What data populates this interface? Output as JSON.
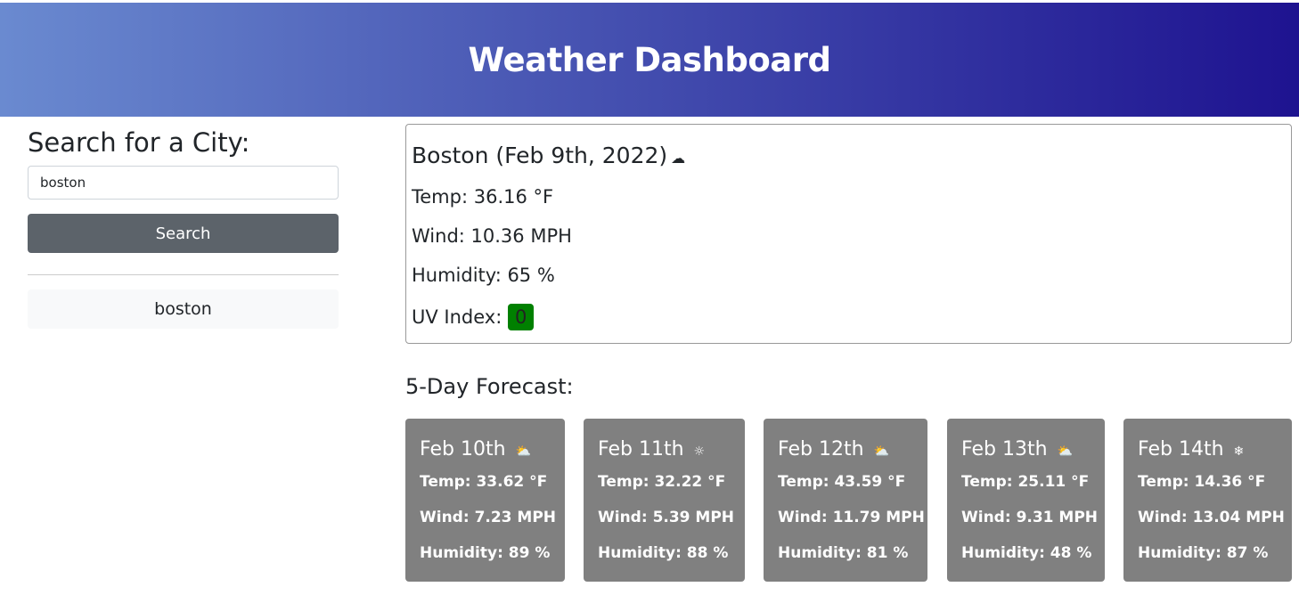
{
  "header": {
    "title": "Weather Dashboard"
  },
  "search": {
    "title": "Search for a City:",
    "value": "boston",
    "button": "Search",
    "history": [
      "boston"
    ]
  },
  "current": {
    "heading": "Boston (Feb 9th, 2022)",
    "icon": "☁",
    "icon_name": "partly-cloudy-icon",
    "temp": "Temp: 36.16 °F",
    "wind": "Wind: 10.36 MPH",
    "humidity": "Humidity: 65 %",
    "uv_label": "UV Index:",
    "uv_value": "0",
    "uv_color": "#008000"
  },
  "forecast": {
    "title": "5-Day Forecast:",
    "days": [
      {
        "date": "Feb 10th",
        "icon": "⛅",
        "icon_name": "partly-cloudy-icon",
        "temp": "Temp: 33.62 °F",
        "wind": "Wind: 7.23 MPH",
        "humidity": "Humidity: 89 %"
      },
      {
        "date": "Feb 11th",
        "icon": "☼",
        "icon_name": "sun-icon",
        "temp": "Temp: 32.22 °F",
        "wind": "Wind: 5.39 MPH",
        "humidity": "Humidity: 88 %"
      },
      {
        "date": "Feb 12th",
        "icon": "⛅",
        "icon_name": "partly-cloudy-icon",
        "temp": "Temp: 43.59 °F",
        "wind": "Wind: 11.79 MPH",
        "humidity": "Humidity: 81 %"
      },
      {
        "date": "Feb 13th",
        "icon": "⛅",
        "icon_name": "partly-cloudy-icon",
        "temp": "Temp: 25.11 °F",
        "wind": "Wind: 9.31 MPH",
        "humidity": "Humidity: 48 %"
      },
      {
        "date": "Feb 14th",
        "icon": "❄",
        "icon_name": "snow-icon",
        "temp": "Temp: 14.36 °F",
        "wind": "Wind: 13.04 MPH",
        "humidity": "Humidity: 87 %"
      }
    ]
  }
}
